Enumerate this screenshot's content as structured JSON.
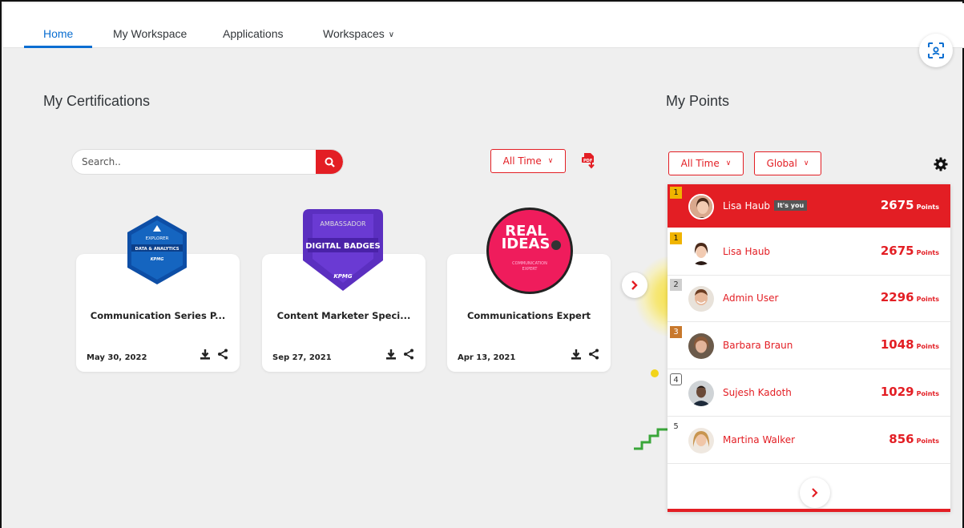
{
  "nav": {
    "tabs": [
      "Home",
      "My Workspace",
      "Applications",
      "Workspaces"
    ],
    "active": "Home"
  },
  "certifications": {
    "title": "My Certifications",
    "search_placeholder": "Search..",
    "filter": "All Time",
    "cards": [
      {
        "name": "Communication Series P...",
        "date": "May 30, 2022",
        "badge_lines": [
          "EXPLORER",
          "DATA & ANALYTICS",
          "KPMG"
        ]
      },
      {
        "name": "Content Marketer Speci...",
        "date": "Sep 27, 2021",
        "badge_lines": [
          "AMBASSADOR",
          "DIGITAL BADGES",
          "KPMG"
        ]
      },
      {
        "name": "Communications Expert",
        "date": "Apr 13, 2021",
        "badge_lines": [
          "REAL",
          "IDEAS",
          "COMMUNICATION",
          "EXPERT"
        ]
      }
    ]
  },
  "points": {
    "title": "My Points",
    "filter_time": "All Time",
    "filter_scope": "Global",
    "me": {
      "rank": "1",
      "name": "Lisa Haub",
      "tag": "It's you",
      "points": "2675",
      "unit": "Points"
    },
    "leaders": [
      {
        "rank": "1",
        "name": "Lisa Haub",
        "points": "2675",
        "unit": "Points"
      },
      {
        "rank": "2",
        "name": "Admin User",
        "points": "2296",
        "unit": "Points"
      },
      {
        "rank": "3",
        "name": "Barbara Braun",
        "points": "1048",
        "unit": "Points"
      },
      {
        "rank": "4",
        "name": "Sujesh Kadoth",
        "points": "1029",
        "unit": "Points"
      },
      {
        "rank": "5",
        "name": "Martina Walker",
        "points": "856",
        "unit": "Points"
      }
    ]
  },
  "colors": {
    "accent": "#e31e24",
    "nav_active": "#0a6ed1",
    "gold": "#f0b400",
    "silver": "#9e9e9e",
    "bronze": "#c8782c"
  },
  "icons": [
    "search-icon",
    "pdf-download-icon",
    "gear-icon",
    "download-icon",
    "share-icon",
    "chevron-right-icon",
    "scan-icon"
  ]
}
